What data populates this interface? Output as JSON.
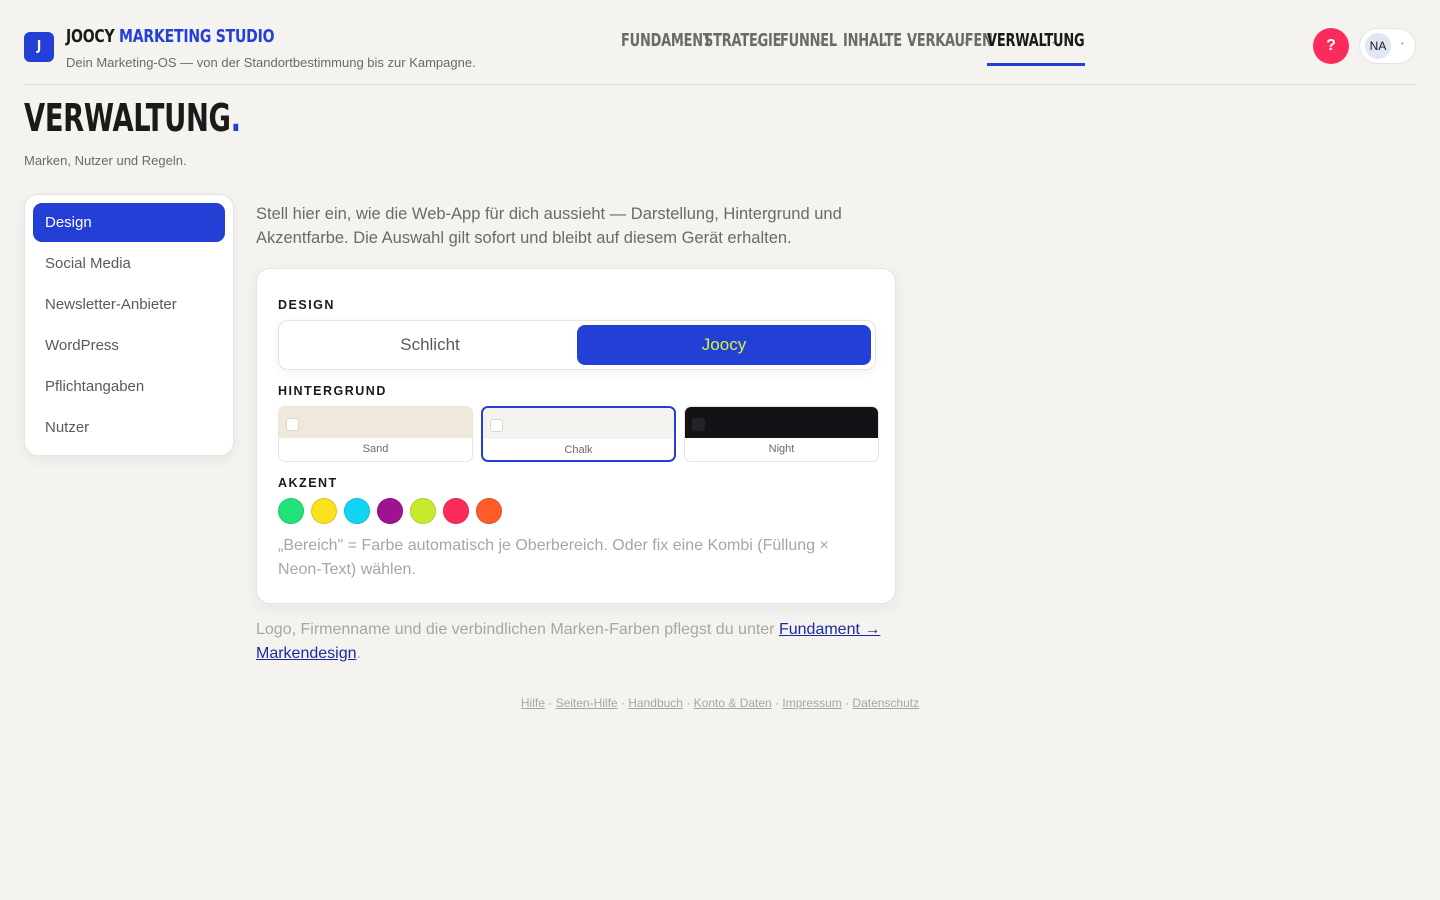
{
  "header": {
    "logo_letter": "J",
    "brand_part1": "JOOCY",
    "brand_part2": "MARKETING STUDIO",
    "tagline": "Dein Marketing-OS — von der Standortbestimmung bis zur Kampagne.",
    "nav": [
      {
        "label": "FUNDAMENT",
        "active": false
      },
      {
        "label": "STRATEGIE",
        "active": false
      },
      {
        "label": "FUNNEL",
        "active": false
      },
      {
        "label": "INHALTE",
        "active": false
      },
      {
        "label": "VERKAUFEN",
        "active": false
      },
      {
        "label": "VERWALTUNG",
        "active": true
      }
    ],
    "nav_dot": "•",
    "help_label": "?",
    "user_initials": "NA"
  },
  "page": {
    "title": "VERWALTUNG",
    "title_dot": ".",
    "subtitle": "Marken, Nutzer und Regeln."
  },
  "sidebar": {
    "items": [
      {
        "label": "Design",
        "active": true
      },
      {
        "label": "Social Media",
        "active": false
      },
      {
        "label": "Newsletter-Anbieter",
        "active": false
      },
      {
        "label": "WordPress",
        "active": false
      },
      {
        "label": "Pflichtangaben",
        "active": false
      },
      {
        "label": "Nutzer",
        "active": false
      }
    ]
  },
  "main": {
    "intro": "Stell hier ein, wie die Web-App für dich aussieht — Darstellung, Hintergrund und Akzentfarbe. Die Auswahl gilt sofort und bleibt auf diesem Gerät erhalten.",
    "design_label": "DESIGN",
    "design_options": [
      {
        "label": "Schlicht",
        "active": false
      },
      {
        "label": "Joocy",
        "active": true
      }
    ],
    "background_label": "HINTERGRUND",
    "backgrounds": [
      {
        "name": "Sand",
        "color": "#f1e8dc",
        "check_color": "#ffffff",
        "active": false
      },
      {
        "name": "Chalk",
        "color": "#f4f3f0",
        "check_color": "#ffffff",
        "active": true
      },
      {
        "name": "Night",
        "color": "#141217",
        "check_color": "#24222a",
        "active": false
      }
    ],
    "accent_label": "AKZENT",
    "accents": [
      "#22e27a",
      "#fbe01f",
      "#12d4f4",
      "#a0138f",
      "#c8ea2c",
      "#fb2c5c",
      "#fd5b2a"
    ],
    "accent_note": "„Bereich\" = Farbe automatisch je Oberbereich. Oder fix eine Kombi (Füllung × Neon-Text) wählen.",
    "bottom_note_prefix": "Logo, Firmenname und die verbindlichen Marken-Farben pflegst du unter ",
    "bottom_note_link": "Fundament → Markendesign",
    "bottom_note_suffix": "."
  },
  "footer": {
    "links": [
      "Hilfe",
      "Seiten-Hilfe",
      "Handbuch",
      "Konto & Daten",
      "Impressum",
      "Datenschutz"
    ],
    "separator": " · "
  },
  "colors": {
    "accent": "#243fd6",
    "neon": "#d6f53a",
    "help": "#fb2c5c",
    "background": "#f4f3f0"
  }
}
